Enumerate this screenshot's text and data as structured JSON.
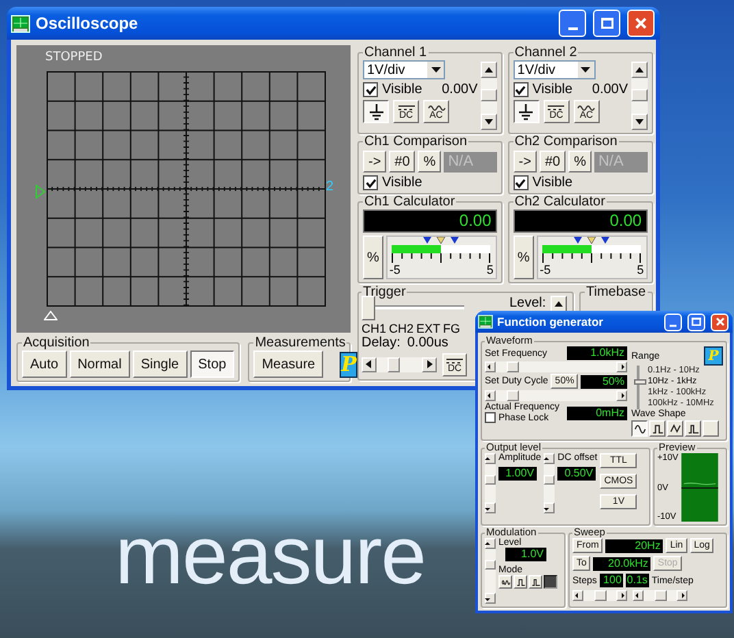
{
  "desktop": {
    "wallpaper_text": "measure"
  },
  "oscilloscope": {
    "title": "Oscilloscope",
    "screen": {
      "status": "STOPPED",
      "marker_label": "2"
    },
    "acquisition": {
      "label": "Acquisition",
      "modes": [
        {
          "label": "Auto",
          "selected": false
        },
        {
          "label": "Normal",
          "selected": false
        },
        {
          "label": "Single",
          "selected": false
        },
        {
          "label": "Stop",
          "selected": true
        }
      ]
    },
    "measurements": {
      "label": "Measurements",
      "button": "Measure",
      "logo": "P"
    },
    "channels": [
      {
        "label": "Channel 1",
        "scale": "1V/div",
        "visible_label": "Visible",
        "visible": true,
        "offset": "0.00V",
        "coupling": [
          {
            "kind": "ground",
            "selected": true
          },
          {
            "kind": "dc",
            "label": "DC",
            "selected": false
          },
          {
            "kind": "ac",
            "label": "AC",
            "selected": false
          }
        ]
      },
      {
        "label": "Channel 2",
        "scale": "1V/div",
        "visible_label": "Visible",
        "visible": true,
        "offset": "0.00V",
        "coupling": [
          {
            "kind": "ground",
            "selected": true
          },
          {
            "kind": "dc",
            "label": "DC",
            "selected": false
          },
          {
            "kind": "ac",
            "label": "AC",
            "selected": false
          }
        ]
      }
    ],
    "comparisons": [
      {
        "label": "Ch1 Comparison",
        "buttons": [
          "->",
          "#0",
          "%"
        ],
        "value": "N/A",
        "visible_label": "Visible",
        "visible": true
      },
      {
        "label": "Ch2 Comparison",
        "buttons": [
          "->",
          "#0",
          "%"
        ],
        "value": "N/A",
        "visible_label": "Visible",
        "visible": true
      }
    ],
    "calculators": [
      {
        "label": "Ch1 Calculator",
        "value": "0.00",
        "button": "%",
        "meter": {
          "level": 0.5,
          "min": "-5",
          "max": "5"
        }
      },
      {
        "label": "Ch2 Calculator",
        "value": "0.00",
        "button": "%",
        "meter": {
          "level": 0.5,
          "min": "-5",
          "max": "5"
        }
      }
    ],
    "trigger": {
      "label": "Trigger",
      "level": 0,
      "level_label": "Level:",
      "sources": [
        "CH1",
        "CH2",
        "EXT",
        "FG"
      ],
      "delay_label": "Delay:",
      "delay": "0.00us",
      "coupling": "DC"
    },
    "timebase": {
      "label": "Timebase"
    }
  },
  "function_generator": {
    "title": "Function generator",
    "waveform": {
      "label": "Waveform",
      "frequency_label": "Set Frequency",
      "frequency": "1.0kHz",
      "duty_label": "Set Duty Cycle",
      "duty_button": "50%",
      "duty": "50%",
      "actual_label": "Actual Frequency",
      "actual": "0mHz",
      "phase_lock": {
        "label": "Phase Lock",
        "checked": false
      }
    },
    "range": {
      "label": "Range",
      "logo": "P",
      "options": [
        {
          "label": "0.1Hz - 10Hz",
          "selected": false
        },
        {
          "label": "10Hz - 1kHz",
          "selected": true
        },
        {
          "label": "1kHz - 100kHz",
          "selected": false
        },
        {
          "label": "100kHz - 10MHz",
          "selected": false
        }
      ]
    },
    "wave_shape": {
      "label": "Wave Shape",
      "shapes": [
        {
          "kind": "sine",
          "selected": true
        },
        {
          "kind": "square",
          "selected": false
        },
        {
          "kind": "triangle",
          "selected": false
        },
        {
          "kind": "pulse",
          "selected": false
        },
        {
          "kind": "blank",
          "selected": false
        }
      ]
    },
    "output": {
      "label": "Output level",
      "amplitude_label": "Amplitude",
      "amplitude": "1.00V",
      "offset_label": "DC offset",
      "offset": "0.50V",
      "presets": [
        "TTL",
        "CMOS",
        "1V"
      ]
    },
    "preview": {
      "label": "Preview",
      "ticks": [
        "+10V",
        "0V",
        "-10V"
      ]
    },
    "modulation": {
      "label": "Modulation",
      "level_label": "Level",
      "level_value": "1.0V",
      "mode_label": "Mode",
      "modes": [
        {
          "kind": "wave",
          "selected": false
        },
        {
          "kind": "square",
          "selected": false
        },
        {
          "kind": "pulse",
          "selected": false
        },
        {
          "kind": "blank",
          "selected": true
        }
      ]
    },
    "sweep": {
      "label": "Sweep",
      "from_button": "From",
      "from": "20Hz",
      "to_button": "To",
      "to": "20.0kHz",
      "scales": [
        "Lin",
        "Log"
      ],
      "stop": {
        "label": "Stop",
        "disabled": true
      },
      "steps_label": "Steps",
      "steps": "100",
      "time": "0.1s",
      "time_label": "Time/step"
    }
  }
}
